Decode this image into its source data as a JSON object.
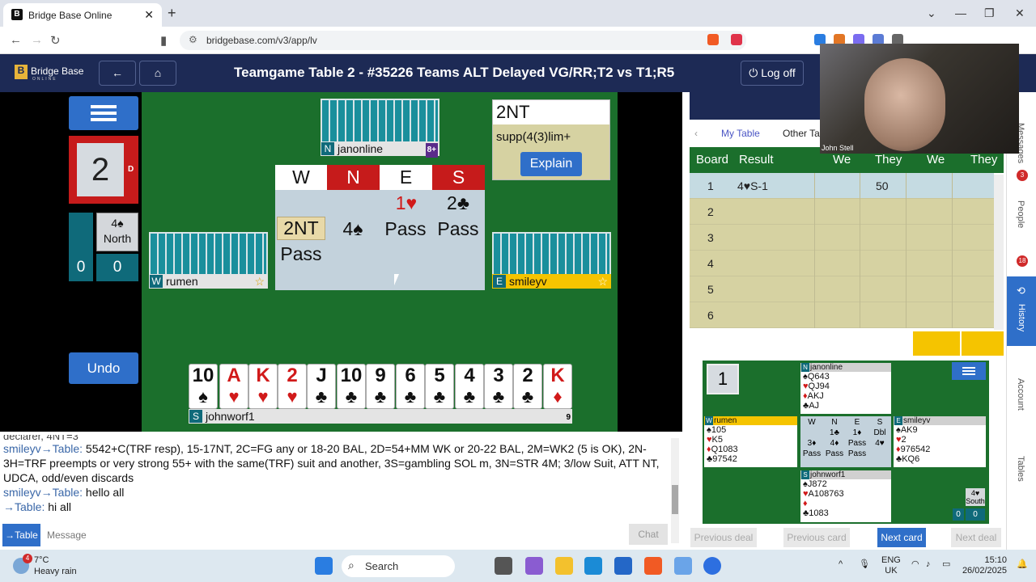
{
  "browser": {
    "tab_title": "Bridge Base Online",
    "tab_favicon": "B",
    "url": "bridgebase.com/v3/app/lv"
  },
  "app": {
    "logo_text": "Bridge Base",
    "logo_sub": "ONLINE",
    "title": "Teamgame Table 2 - #35226 Teams ALT Delayed VG/RR;T2 vs T1;R5",
    "logoff_label": "Log off"
  },
  "board": {
    "number": "2",
    "dealer": "D",
    "contract_level": "4♠",
    "declarer": "North",
    "score_left": "0",
    "score_right": "0",
    "undo_label": "Undo"
  },
  "players": {
    "north": {
      "seat": "N",
      "name": "janonline",
      "rank": "8+"
    },
    "west": {
      "seat": "W",
      "name": "rumen"
    },
    "east": {
      "seat": "E",
      "name": "smileyv"
    },
    "south": {
      "seat": "S",
      "name": "johnworf1",
      "rank": "9"
    }
  },
  "auction": {
    "headers": [
      "W",
      "N",
      "E",
      "S"
    ],
    "row1": [
      "",
      "",
      "1♥",
      "2♣"
    ],
    "row2": [
      "2NT",
      "4♠",
      "Pass",
      "Pass"
    ],
    "row3": [
      "Pass"
    ]
  },
  "bid_explanation": {
    "bid": "2NT",
    "text": "supp(4(3)lim+",
    "button": "Explain"
  },
  "south_hand": [
    {
      "rank": "10",
      "suit": "♠",
      "color": "blk"
    },
    {
      "rank": "A",
      "suit": "♥",
      "color": "red"
    },
    {
      "rank": "K",
      "suit": "♥",
      "color": "red"
    },
    {
      "rank": "2",
      "suit": "♥",
      "color": "red"
    },
    {
      "rank": "J",
      "suit": "♣",
      "color": "blk"
    },
    {
      "rank": "10",
      "suit": "♣",
      "color": "blk"
    },
    {
      "rank": "9",
      "suit": "♣",
      "color": "blk"
    },
    {
      "rank": "6",
      "suit": "♣",
      "color": "blk"
    },
    {
      "rank": "5",
      "suit": "♣",
      "color": "blk"
    },
    {
      "rank": "4",
      "suit": "♣",
      "color": "blk"
    },
    {
      "rank": "3",
      "suit": "♣",
      "color": "blk"
    },
    {
      "rank": "2",
      "suit": "♣",
      "color": "blk"
    },
    {
      "rank": "K",
      "suit": "♦",
      "color": "red"
    }
  ],
  "chat": {
    "line0": "declarer, 4NT=3",
    "line1_who": "smileyv→Table:",
    "line1": " 5542+C(TRF resp), 15-17NT, 2C=FG any or 18-20 BAL, 2D=54+MM WK or 20-22 BAL, 2M=WK2 (5 is OK), 2N-3H=TRF preempts or very strong 55+ with the same(TRF) suit and another, 3S=gambling SOL m, 3N=STR 4M; 3/low Suit, ATT NT, UDCA, odd/even discards",
    "line2_who": "smileyv→Table:",
    "line2": " hello all",
    "line3_who": "→Table:",
    "line3": " hi all",
    "to_label": "→Table",
    "placeholder": "Message",
    "send_label": "Chat"
  },
  "results": {
    "tab_my": "My Table",
    "tab_other": "Other Tab",
    "headers": [
      "Board",
      "Result",
      "We",
      "They",
      "We",
      "They"
    ],
    "rows": [
      {
        "board": "1",
        "result": "4♥S-1",
        "they": "50"
      },
      {
        "board": "2"
      },
      {
        "board": "3"
      },
      {
        "board": "4"
      },
      {
        "board": "5"
      },
      {
        "board": "6"
      }
    ]
  },
  "review": {
    "board": "1",
    "north": {
      "name": "janonline",
      "rank": "8+",
      "s": "♠Q643",
      "h": "♥QJ94",
      "d": "♦AKJ",
      "c": "♣AJ"
    },
    "west": {
      "name": "rumen",
      "s": "♠105",
      "h": "♥K5",
      "d": "♦Q1083",
      "c": "♣97542"
    },
    "east": {
      "name": "smileyv",
      "s": "♠AK9",
      "h": "♥2",
      "d": "♦976542",
      "c": "♣KQ6"
    },
    "south": {
      "name": "johnworf1",
      "rank": "9",
      "s": "♠J872",
      "h": "♥A108763",
      "d": "♦",
      "c": "♣1083"
    },
    "auction": {
      "h": [
        "W",
        "N",
        "E",
        "S"
      ],
      "r1": [
        "",
        "1♣",
        "1♦",
        "Dbl"
      ],
      "r2": [
        "3♦",
        "4♦",
        "Pass",
        "4♥"
      ],
      "r3": [
        "Pass",
        "Pass",
        "Pass"
      ]
    },
    "contract": "4♥",
    "declarer": "South",
    "scores": [
      "0",
      "0"
    ],
    "buttons": {
      "prev_deal": "Previous deal",
      "prev_card": "Previous card",
      "next_card": "Next card",
      "next_deal": "Next deal"
    }
  },
  "sidebar": {
    "messages": "Messages",
    "messages_badge": "3",
    "people": "People",
    "people_badge": "18",
    "history": "History",
    "account": "Account",
    "tables": "Tables"
  },
  "webcam": {
    "name": "John Stell"
  },
  "taskbar": {
    "temp": "7°C",
    "weather": "Heavy rain",
    "weather_badge": "4",
    "search": "Search",
    "lang1": "ENG",
    "lang2": "UK",
    "time": "15:10",
    "date": "26/02/2025"
  }
}
